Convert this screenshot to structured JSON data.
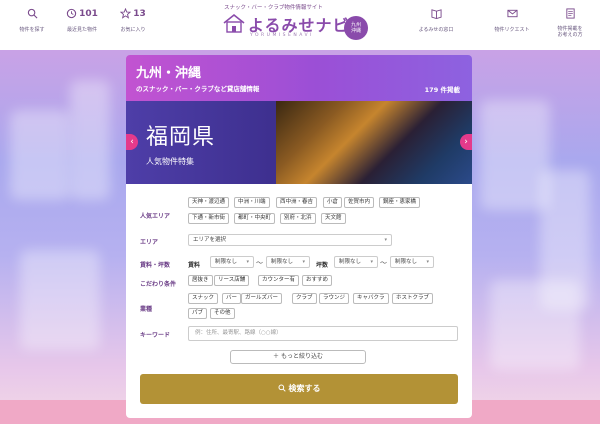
{
  "header": {
    "nav_left": [
      {
        "icon": "search-icon",
        "label": "物件を探す"
      },
      {
        "icon": "history-icon",
        "label": "最近見た物件",
        "count": "101"
      },
      {
        "icon": "star-icon",
        "label": "お気に入り",
        "count": "13"
      }
    ],
    "nav_right": [
      {
        "icon": "book-icon",
        "label": "よるみせの窓口"
      },
      {
        "icon": "mail-icon",
        "label": "物件リクエスト"
      },
      {
        "icon": "document-icon",
        "label": "物件掲載を\nお考えの方"
      }
    ],
    "logo": {
      "tagline": "スナック・バー・クラブ物件情報サイト",
      "name": "よるみせナビ",
      "romaji": "YORUMISENAVI",
      "badge": "九州\n沖縄"
    }
  },
  "region": {
    "title": "九州・沖縄",
    "subtitle": "のスナック・バー・クラブなど貸店舗情報",
    "count": "179 件掲載"
  },
  "feature": {
    "title": "福岡県",
    "subtitle": "人気物件特集",
    "prev": "‹",
    "next": "›"
  },
  "search": {
    "popular_area": {
      "label": "人気エリア",
      "tags": [
        "天神・渡辺通",
        "中洲・川端",
        "西中洲・春吉",
        "小倉",
        "佐賀市内",
        "鋼座・恵家橋",
        "下通・新市街",
        "都町・中央町",
        "別府・北浜",
        "天文館"
      ]
    },
    "area": {
      "label": "エリア",
      "value": "エリアを選択"
    },
    "rent": {
      "label": "賃料・坪数",
      "rent_label": "賃料",
      "tsubo_label": "坪数",
      "min": "制限なし",
      "max": "制限なし",
      "tsubo_min": "制限なし",
      "tsubo_max": "制限なし",
      "tilde": "〜"
    },
    "conditions": {
      "label": "こだわり条件",
      "tags": [
        "居抜き",
        "リース店舗",
        "カウンター有",
        "おすすめ"
      ]
    },
    "business": {
      "label": "業種",
      "tags": [
        "スナック",
        "バー",
        "ガールズバー",
        "クラブ",
        "ラウンジ",
        "キャバクラ",
        "ホストクラブ",
        "パブ",
        "その他"
      ]
    },
    "keyword": {
      "label": "キーワード",
      "placeholder": "例：住所、最寄駅、路線（○○線）"
    },
    "more_button": "＋ もっと絞り込む",
    "search_button": "検索する"
  },
  "colors": {
    "accent_purple": "#8a4bab",
    "search_gold": "#b39236",
    "arrow_pink": "#e43a8b"
  }
}
